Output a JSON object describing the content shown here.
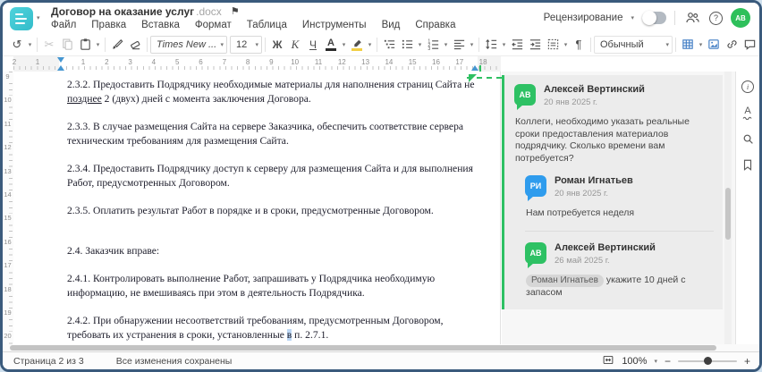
{
  "colors": {
    "accent_teal": "#3ec6d0",
    "brand_green": "#2ec164",
    "brand_blue": "#2f9ced",
    "toolbar_blue": "#3f7cc4",
    "selection_highlight": "#bcd7f5",
    "anchor_green": "#2fc062"
  },
  "header": {
    "title": "Договор на оказание услуг",
    "title_ext": ".docx",
    "menus": [
      "Файл",
      "Правка",
      "Вставка",
      "Формат",
      "Таблица",
      "Инструменты",
      "Вид",
      "Справка"
    ],
    "review_label": "Рецензирование",
    "avatar_initials": "АВ"
  },
  "toolbar": {
    "font_name": "Times New ...",
    "font_size": "12",
    "bold": "Ж",
    "italic": "К",
    "underline": "Ч",
    "font_color": "А",
    "style_name": "Обычный"
  },
  "ruler": {
    "h_left": [
      "1",
      "2"
    ],
    "h_right": [
      "1",
      "2",
      "3",
      "4",
      "5",
      "6",
      "7",
      "8",
      "9",
      "10",
      "11",
      "12",
      "13",
      "14",
      "15",
      "16",
      "17",
      "18"
    ],
    "vertical": [
      "9",
      "10",
      "11",
      "12",
      "13",
      "14",
      "15",
      "16",
      "17",
      "18",
      "19",
      "20"
    ]
  },
  "document": {
    "p232_before": "2.3.2. Предоставить Подрядчику необходимые материалы для наполнения страниц Сайта не ",
    "p232_underlined": "позднее",
    "p232_after": " 2 (двух) дней с момента заключения Договора.",
    "p233": "2.3.3. В случае размещения Сайта на сервере Заказчика, обеспечить соответствие сервера техническим требованиям для размещения Сайта.",
    "p234": "2.3.4. Предоставить Подрядчику доступ к серверу для размещения Сайта и для выполнения Работ, предусмотренных Договором.",
    "p235": "2.3.5. Оплатить результат Работ в порядке и в сроки, предусмотренные Договором.",
    "p24": "2.4. Заказчик вправе:",
    "p241": "2.4.1. Контролировать выполнение Работ, запрашивать у Подрядчика необходимую информацию, не вмешиваясь при этом в деятельность Подрядчика.",
    "p242_before": "2.4.2. При обнаружении несоответствий требованиям, предусмотренным Договором, требовать их устранения в сроки, установленные ",
    "p242_highlighted": "в",
    "p242_after": " п. 2.7.1."
  },
  "comments": {
    "root": {
      "initials": "АВ",
      "name": "Алексей Вертинский",
      "date": "20 янв 2025 г.",
      "text": "Коллеги, необходимо указать реальные сроки предоставления материалов подрядчику. Сколько времени вам потребуется?"
    },
    "replies": [
      {
        "initials": "РИ",
        "name": "Роман Игнатьев",
        "date": "20 янв 2025 г.",
        "text": "Нам потребуется неделя"
      },
      {
        "initials": "АВ",
        "name": "Алексей Вертинский",
        "date": "26 май 2025 г.",
        "mention": "Роман Игнатьев",
        "text": " укажите 10 дней с запасом"
      }
    ]
  },
  "statusbar": {
    "page_info": "Страница 2 из 3",
    "saved_status": "Все изменения сохранены",
    "zoom_level": "100%"
  },
  "icons": {
    "undo": "↺",
    "scissors": "✂",
    "pilcrow": "¶",
    "more": "⋯",
    "flag": "⚑",
    "help": "?",
    "info": "i",
    "minus": "−",
    "plus": "+",
    "caret": "▾"
  }
}
